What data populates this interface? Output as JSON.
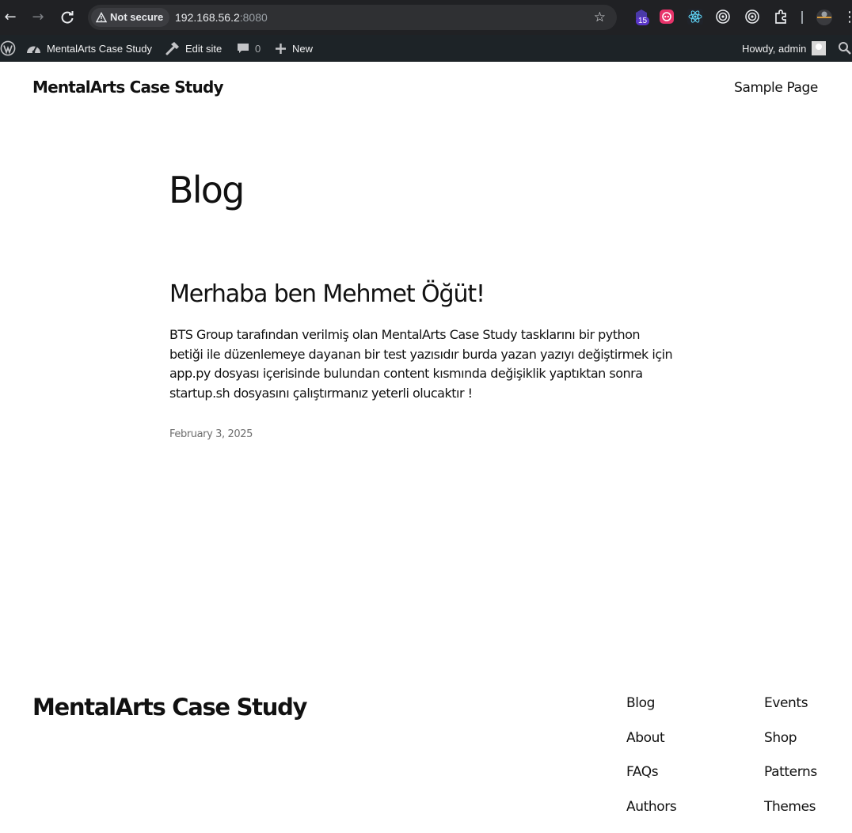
{
  "browser": {
    "security_label": "Not secure",
    "url_host": "192.168.56.2",
    "url_port": ":8080",
    "extension_badge": "15"
  },
  "admin_bar": {
    "site_name": "MentalArts Case Study",
    "edit_site": "Edit site",
    "comments_count": "0",
    "new_label": "New",
    "howdy": "Howdy, admin"
  },
  "header": {
    "site_title": "MentalArts Case Study",
    "nav_sample_page": "Sample Page"
  },
  "main": {
    "page_heading": "Blog",
    "post": {
      "title": "Merhaba ben Mehmet Öğüt!",
      "excerpt_lines": [
        "BTS Group tarafından verilmiş olan MentalArts Case Study tasklarını bir python",
        "betiği ile düzenlemeye dayanan bir test yazısıdır burda yazan yazıyı değiştirmek için",
        "app.py dosyası içerisinde bulundan content kısmında değişiklik yaptıktan sonra",
        "startup.sh dosyasını çalıştırmanız yeterli olucaktır !"
      ],
      "date": "February 3, 2025"
    }
  },
  "footer": {
    "site_title": "MentalArts Case Study",
    "col1": [
      "Blog",
      "About",
      "FAQs",
      "Authors"
    ],
    "col2": [
      "Events",
      "Shop",
      "Patterns",
      "Themes"
    ]
  },
  "colors": {
    "browser_bg": "#202124",
    "omnibox_bg": "#2f3033",
    "admin_bar_bg": "#1d2327",
    "text": "#111111",
    "date_text": "#6e6e6e"
  }
}
